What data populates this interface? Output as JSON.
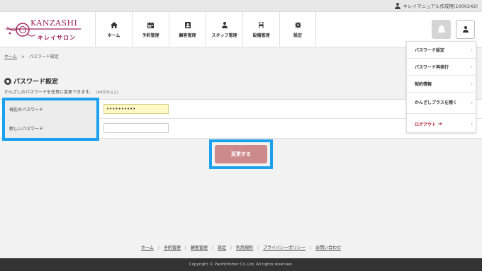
{
  "topbar": {
    "user_label": "キレイマニュアル作成用(1000242)"
  },
  "brand": {
    "name": "KANZASHI",
    "sub": "キレイサロン",
    "color": "#a0245a"
  },
  "nav": [
    {
      "label": "ホーム",
      "icon": "home-icon"
    },
    {
      "label": "予約管理",
      "icon": "calendar-icon"
    },
    {
      "label": "顧客管理",
      "icon": "contact-card-icon"
    },
    {
      "label": "スタッフ管理",
      "icon": "user-icon"
    },
    {
      "label": "設備管理",
      "icon": "chair-icon"
    },
    {
      "label": "設定",
      "icon": "gear-icon"
    }
  ],
  "breadcrumb": {
    "home": "ホーム",
    "separator": ">",
    "current": "パスワード設定"
  },
  "page": {
    "title": "パスワード設定",
    "subtitle": "かんざしのパスワードを任意に変更できます。",
    "note": "(※8文字以上)"
  },
  "form": {
    "current_label": "現在のパスワード",
    "current_value": "••••••••••",
    "new_label": "新しいパスワード",
    "new_value": "",
    "submit": "変更する"
  },
  "dropdown": {
    "items": [
      {
        "label": "パスワード設定"
      },
      {
        "label": "パスワード再発行"
      },
      {
        "label": "契約情報"
      },
      {
        "label": "かんざしプラスを開く"
      },
      {
        "label": "ログアウト"
      }
    ],
    "chevron": "›"
  },
  "footer": {
    "links": [
      "ホーム",
      "予約管理",
      "顧客管理",
      "設定",
      "利用規約",
      "プライバシーポリシー",
      "お問い合わせ"
    ],
    "copyright": "Copyright © PacificPorter Co.,Ltd. All rights reserved."
  },
  "colors": {
    "highlight": "#1ca0f0",
    "submit_bg": "#cc8a8d",
    "logout": "#b0202f",
    "filled_input": "#fdf9c4"
  }
}
